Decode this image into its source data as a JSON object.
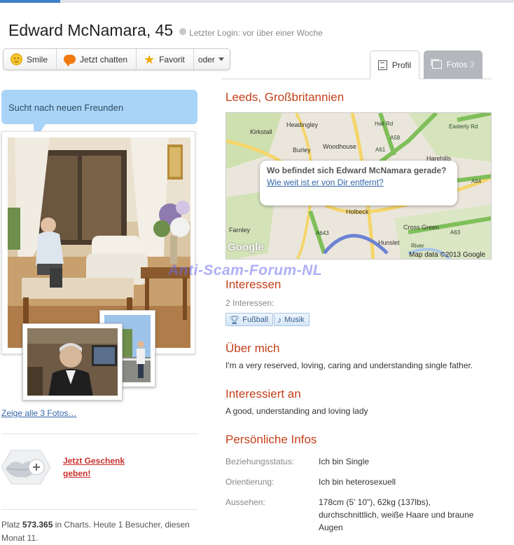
{
  "profile": {
    "name": "Edward McNamara, 45",
    "last_login": "Letzter Login: vor über einer Woche"
  },
  "actions": {
    "smile": "Smile",
    "chat": "Jetzt chatten",
    "favorite": "Favorit",
    "more": "oder"
  },
  "tabs": {
    "profile": "Profil",
    "photos": "Fotos",
    "photos_count": "3"
  },
  "status_bubble": "Sucht nach neuen Freunden",
  "show_photos_link": "Zeige alle 3 Fotos…",
  "gift": {
    "line1": "Jetzt Geschenk",
    "line2": "geben!"
  },
  "charts": {
    "prefix": "Platz ",
    "rank": "573.365",
    "suffix": " in Charts. Heute 1 Besucher, diesen Monat 11."
  },
  "location": {
    "title": "Leeds, Großbritannien",
    "popup_question": "Wo befindet sich Edward McNamara gerade?",
    "popup_link": "Wie weit ist er von Dir entfernt?",
    "map_credit": "Map data ©2013 Google",
    "google_logo": "Google",
    "place_labels": [
      "Kirkstall",
      "Headingley",
      "Burley",
      "Woodhouse",
      "Harehills",
      "Holbeck",
      "Farnley",
      "Cross Green",
      "Hunslet"
    ],
    "road_labels": [
      "A58",
      "A61",
      "A64",
      "A63",
      "A643",
      "Easterly Rd",
      "Hall Rd",
      "River"
    ]
  },
  "watermark": "Anti-Scam-Forum-NL",
  "interests": {
    "title": "Interessen",
    "count": "2 Interessen:",
    "tags": [
      "Fußball",
      "Musik"
    ]
  },
  "about": {
    "title": "Über mich",
    "text": "I'm a very reserved, loving, caring and understanding single father."
  },
  "interested_in": {
    "title": "Interessiert an",
    "text": "A good, understanding and loving lady"
  },
  "personal": {
    "title": "Persönliche Infos",
    "rows": [
      {
        "label": "Beziehungsstatus:",
        "value": "Ich bin Single"
      },
      {
        "label": "Orientierung:",
        "value": "Ich bin heterosexuell"
      },
      {
        "label": "Aussehen:",
        "value": "178cm (5' 10\"), 62kg (137lbs), durchschnittlich, weiße Haare und braune Augen"
      }
    ]
  },
  "colors": {
    "section_title": "#c3401b",
    "bubble": "#a9d4f7",
    "link": "#3366aa",
    "gift_link": "#c9302c"
  }
}
